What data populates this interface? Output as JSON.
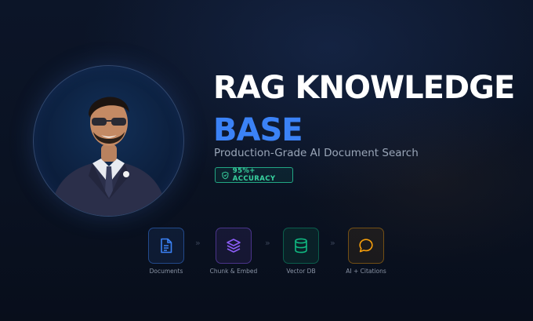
{
  "title": {
    "line1": "RAG KNOWLEDGE",
    "line2": "BASE"
  },
  "subtitle": "Production-Grade AI Document Search",
  "badge": {
    "text": "95%+ ACCURACY",
    "icon": "shield-check-icon",
    "color": "#38d3a0"
  },
  "pipeline": {
    "steps": [
      {
        "label": "Documents",
        "icon": "document-icon",
        "color": "#3b82f6"
      },
      {
        "label": "Chunk & Embed",
        "icon": "layers-icon",
        "color": "#8b5cf6"
      },
      {
        "label": "Vector DB",
        "icon": "database-icon",
        "color": "#10b981"
      },
      {
        "label": "AI + Citations",
        "icon": "chat-bubble-icon",
        "color": "#f59e0b"
      }
    ],
    "separator": "»"
  },
  "colors": {
    "accent": "#3b82f6",
    "background": "#0b1120"
  }
}
